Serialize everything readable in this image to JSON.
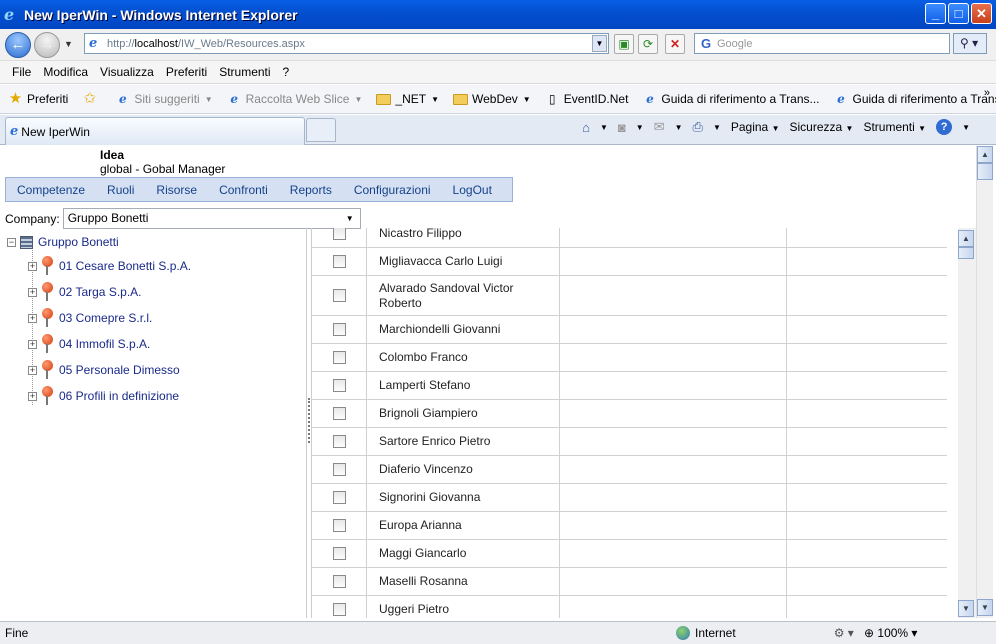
{
  "window": {
    "title": "New IperWin - Windows Internet Explorer",
    "minimize": "_",
    "maximize": "□",
    "close": "✕"
  },
  "address": {
    "url_prefix": "http://",
    "url_host": "localhost",
    "url_path": "/IW_Web/Resources.aspx"
  },
  "search": {
    "placeholder": "Google"
  },
  "menu": [
    "File",
    "Modifica",
    "Visualizza",
    "Preferiti",
    "Strumenti",
    "?"
  ],
  "favorites": {
    "label": "Preferiti",
    "items": [
      {
        "label": "Siti suggeriti",
        "icon": "ie-page-icon",
        "gray": true,
        "dropdown": true
      },
      {
        "label": "Raccolta Web Slice",
        "icon": "ie-page-icon",
        "gray": true,
        "dropdown": true
      },
      {
        "label": "_NET",
        "icon": "folder-icon",
        "gray": false,
        "dropdown": true
      },
      {
        "label": "WebDev",
        "icon": "folder-icon",
        "gray": false,
        "dropdown": true
      },
      {
        "label": "EventID.Net",
        "icon": "page-icon",
        "gray": false,
        "dropdown": false
      },
      {
        "label": "Guida di riferimento a Trans...",
        "icon": "ie-page-icon",
        "gray": false,
        "dropdown": false
      },
      {
        "label": "Guida di riferimento a Trans...",
        "icon": "ie-page-icon",
        "gray": false,
        "dropdown": false
      }
    ]
  },
  "tab": {
    "label": "New IperWin"
  },
  "commandbar": {
    "page": "Pagina",
    "security": "Sicurezza",
    "tools": "Strumenti"
  },
  "app": {
    "brand": "Idea",
    "subtitle": "global  -  Gobal Manager",
    "nav": [
      "Competenze",
      "Ruoli",
      "Risorse",
      "Confronti",
      "Reports",
      "Configurazioni",
      "LogOut"
    ],
    "company_label": "Company:",
    "company_value": "Gruppo Bonetti"
  },
  "tree": {
    "root": "Gruppo Bonetti",
    "children": [
      "01 Cesare Bonetti S.p.A.",
      "02 Targa S.p.A.",
      "03 Comepre S.r.l.",
      "04 Immofil S.p.A.",
      "05 Personale Dimesso",
      "06 Profili in definizione"
    ]
  },
  "resources": [
    "Nicastro Filippo",
    "Migliavacca Carlo Luigi",
    "Alvarado Sandoval Victor Roberto",
    "Marchiondelli Giovanni",
    "Colombo Franco",
    "Lamperti Stefano",
    "Brignoli Giampiero",
    "Sartore Enrico Pietro",
    "Diaferio Vincenzo",
    "Signorini Giovanna",
    "Europa Arianna",
    "Maggi Giancarlo",
    "Maselli Rosanna",
    "Uggeri Pietro"
  ],
  "status": {
    "text": "Fine",
    "zone": "Internet",
    "zoom": "100%"
  }
}
